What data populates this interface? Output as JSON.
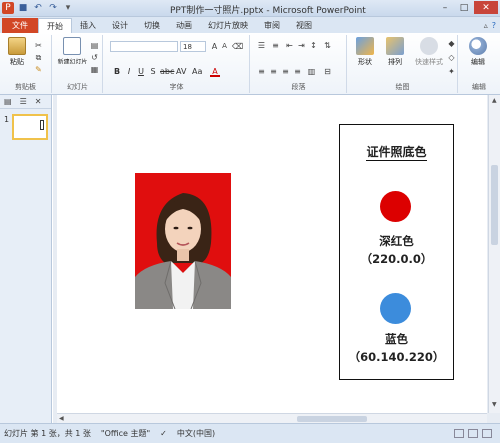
{
  "window": {
    "title": "PPT制作一寸照片.pptx - Microsoft PowerPoint"
  },
  "quick_access": {
    "icons": [
      "powerpoint-icon",
      "save-icon",
      "undo-icon",
      "redo-icon",
      "customize-icon"
    ]
  },
  "tabs": [
    {
      "label": "文件"
    },
    {
      "label": "开始"
    },
    {
      "label": "插入"
    },
    {
      "label": "设计"
    },
    {
      "label": "切换"
    },
    {
      "label": "动画"
    },
    {
      "label": "幻灯片放映"
    },
    {
      "label": "审阅"
    },
    {
      "label": "视图"
    }
  ],
  "ribbon": {
    "groups": {
      "clipboard": {
        "label": "剪贴板",
        "paste": "粘贴"
      },
      "slides": {
        "label": "幻灯片",
        "new_slide": "新建幻灯片"
      },
      "font": {
        "label": "字体",
        "size": "18"
      },
      "paragraph": {
        "label": "段落"
      },
      "drawing": {
        "label": "绘图",
        "shape": "形状",
        "arrange": "排列",
        "quick_styles": "快速样式"
      },
      "editing": {
        "label": "编辑",
        "edit": "编辑"
      }
    }
  },
  "left_pane": {
    "slide_number": "1"
  },
  "slide": {
    "card": {
      "title": "证件照底色",
      "colors": [
        {
          "name": "深红色",
          "value": "（220.0.0）",
          "hex": "#dc0000"
        },
        {
          "name": "蓝色",
          "value": "（60.140.220）",
          "hex": "#3c8cdc"
        }
      ]
    },
    "photo": {
      "background": "#e00e0e"
    }
  },
  "status": {
    "slide_info": "幻灯片 第 1 张，共 1 张",
    "theme": "\"Office 主题\"",
    "language": "中文(中国)"
  }
}
